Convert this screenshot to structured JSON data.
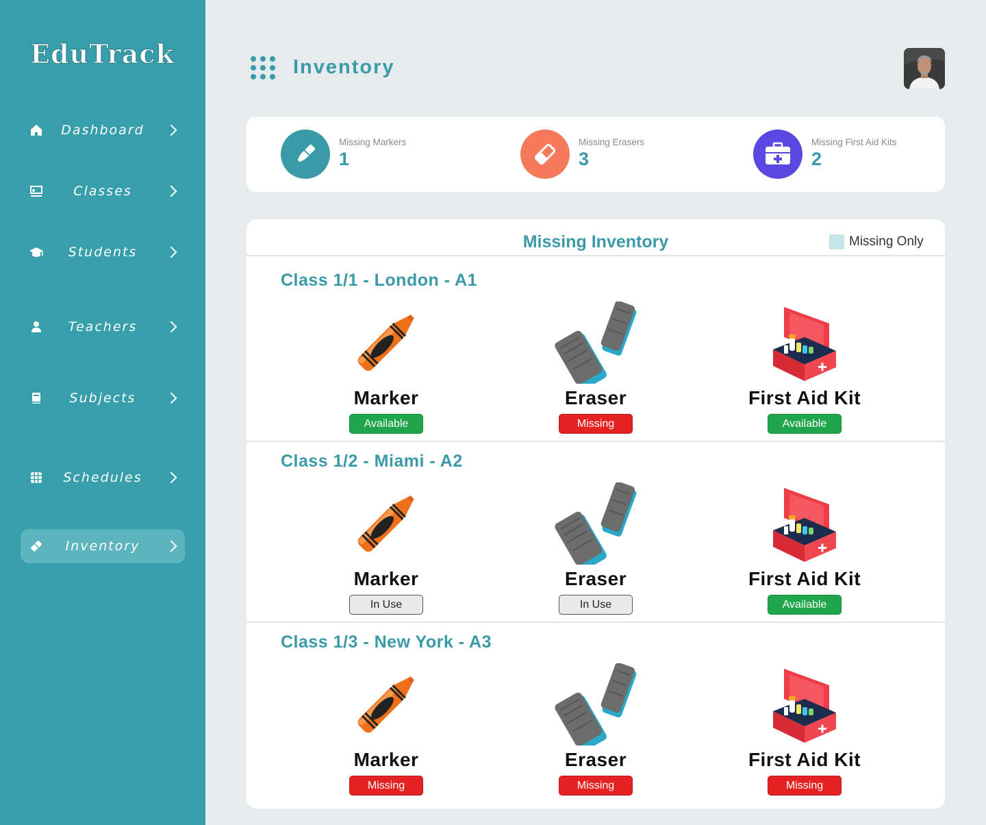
{
  "app": {
    "name": "EduTrack"
  },
  "sidebar": {
    "items": [
      {
        "label": "Dashboard",
        "icon": "home-icon"
      },
      {
        "label": "Classes",
        "icon": "classroom-icon"
      },
      {
        "label": "Students",
        "icon": "graduation-cap-icon"
      },
      {
        "label": "Teachers",
        "icon": "person-icon"
      },
      {
        "label": "Subjects",
        "icon": "book-icon"
      },
      {
        "label": "Schedules",
        "icon": "grid-calendar-icon"
      },
      {
        "label": "Inventory",
        "icon": "eraser-icon",
        "active": true
      }
    ]
  },
  "header": {
    "title": "Inventory"
  },
  "stats": [
    {
      "label": "Missing Markers",
      "value": "1",
      "color": "#3a9ba7",
      "icon": "marker-icon"
    },
    {
      "label": "Missing Erasers",
      "value": "3",
      "color": "#f57a5c",
      "icon": "eraser-icon"
    },
    {
      "label": "Missing First Aid Kits",
      "value": "2",
      "color": "#5b48e3",
      "icon": "first-aid-kit-icon"
    }
  ],
  "main": {
    "title": "Missing Inventory",
    "filter_label": "Missing Only",
    "classes": [
      {
        "title": "Class 1/1 - London - A1",
        "items": [
          {
            "name": "Marker",
            "status": "Available"
          },
          {
            "name": "Eraser",
            "status": "Missing"
          },
          {
            "name": "First Aid Kit",
            "status": "Available"
          }
        ]
      },
      {
        "title": "Class 1/2 - Miami - A2",
        "items": [
          {
            "name": "Marker",
            "status": "In Use"
          },
          {
            "name": "Eraser",
            "status": "In Use"
          },
          {
            "name": "First Aid Kit",
            "status": "Available"
          }
        ]
      },
      {
        "title": "Class 1/3 - New York - A3",
        "items": [
          {
            "name": "Marker",
            "status": "Missing"
          },
          {
            "name": "Eraser",
            "status": "Missing"
          },
          {
            "name": "First Aid Kit",
            "status": "Missing"
          }
        ]
      }
    ]
  }
}
